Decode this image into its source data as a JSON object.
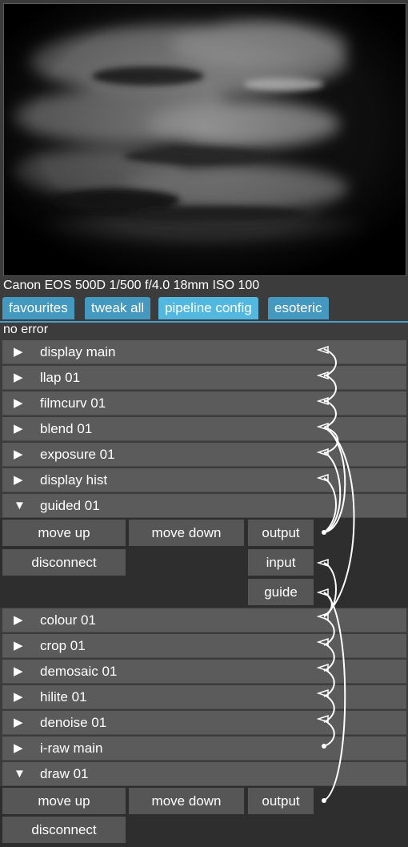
{
  "exif": "Canon EOS 500D 1/500 f/4.0 18mm ISO 100",
  "tabs": [
    "favourites",
    "tweak all",
    "pipeline config",
    "esoteric"
  ],
  "status": "no error",
  "modules": [
    {
      "label": "display main",
      "expanded": false
    },
    {
      "label": "llap 01",
      "expanded": false
    },
    {
      "label": "filmcurv 01",
      "expanded": false
    },
    {
      "label": "blend 01",
      "expanded": false
    },
    {
      "label": "exposure 01",
      "expanded": false
    },
    {
      "label": "display hist",
      "expanded": false
    },
    {
      "label": "guided 01",
      "expanded": true
    },
    {
      "label": "colour 01",
      "expanded": false
    },
    {
      "label": "crop 01",
      "expanded": false
    },
    {
      "label": "demosaic 01",
      "expanded": false
    },
    {
      "label": "hilite 01",
      "expanded": false
    },
    {
      "label": "denoise 01",
      "expanded": false
    },
    {
      "label": "i-raw main",
      "expanded": false
    },
    {
      "label": "draw 01",
      "expanded": true
    }
  ],
  "guided_panel": {
    "move_up": "move up",
    "move_down": "move down",
    "disconnect": "disconnect",
    "connectors": [
      "output",
      "input",
      "guide"
    ]
  },
  "draw_panel": {
    "move_up": "move up",
    "move_down": "move down",
    "disconnect": "disconnect",
    "connectors": [
      "output"
    ]
  },
  "icons": {
    "collapsed": "triangle-right-icon",
    "expanded": "triangle-down-icon"
  },
  "colors": {
    "tab": "#4499c0",
    "tab_active": "#52b8e0",
    "background": "#3c3c3c"
  }
}
